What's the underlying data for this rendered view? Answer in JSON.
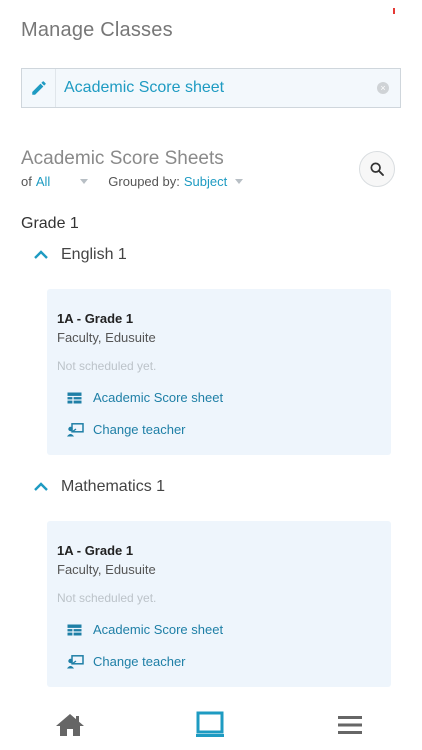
{
  "header": {
    "title": "Manage Classes"
  },
  "selector": {
    "label": "Academic Score sheet"
  },
  "section": {
    "title": "Academic Score Sheets",
    "of_label": "of",
    "of_value": "All",
    "group_label": "Grouped by:",
    "group_value": "Subject"
  },
  "grade": {
    "title": "Grade 1"
  },
  "subjects": [
    {
      "name": "English 1",
      "card": {
        "class_name": "1A - Grade 1",
        "teacher": "Faculty, Edusuite",
        "schedule": "Not scheduled yet.",
        "action_sheet": "Academic Score sheet",
        "action_teacher": "Change teacher"
      }
    },
    {
      "name": "Mathematics 1",
      "card": {
        "class_name": "1A - Grade 1",
        "teacher": "Faculty, Edusuite",
        "schedule": "Not scheduled yet.",
        "action_sheet": "Academic Score sheet",
        "action_teacher": "Change teacher"
      }
    }
  ],
  "nav": {
    "items": [
      "home-icon",
      "classroom-icon",
      "menu-icon"
    ],
    "active": "classroom-icon"
  },
  "colors": {
    "accent": "#1e9bc2",
    "card_bg": "#eef5fc",
    "nav_icon": "#666666"
  }
}
